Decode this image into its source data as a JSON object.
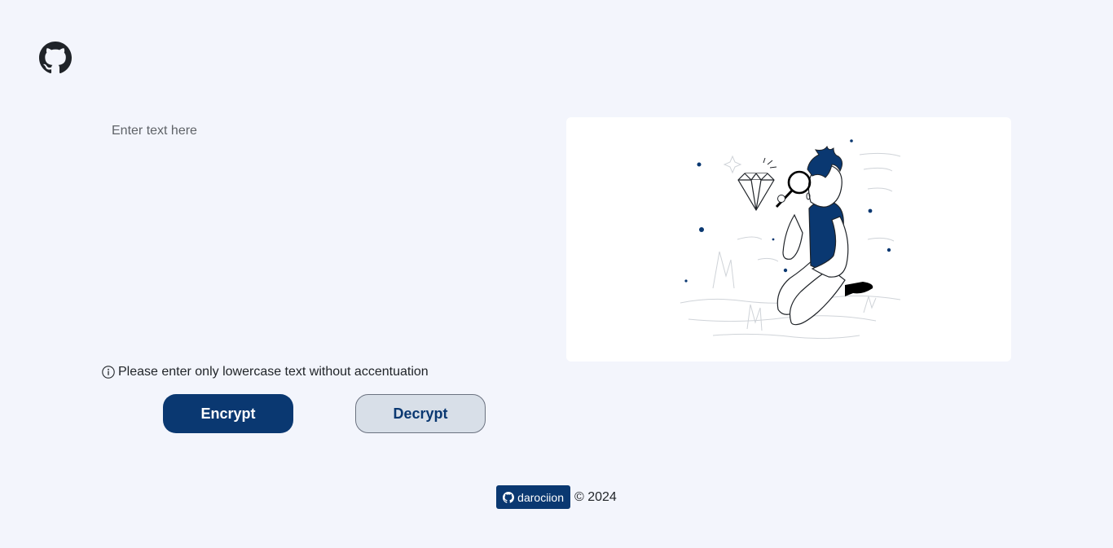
{
  "header": {
    "logo_icon": "github-icon"
  },
  "editor": {
    "placeholder": "Enter text here",
    "value": ""
  },
  "info": {
    "icon": "info-circle-icon",
    "text": "Please enter only lowercase text without accentuation"
  },
  "actions": {
    "encrypt_label": "Encrypt",
    "decrypt_label": "Decrypt"
  },
  "illustration": {
    "subject": "person-with-magnifying-glass-and-diamond"
  },
  "footer": {
    "author_icon": "github-icon",
    "author": "darociion",
    "copyright": "© 2024"
  },
  "colors": {
    "background": "#f3f5fc",
    "primary": "#0a3871",
    "secondary_button": "#d8dfe8",
    "card": "#ffffff"
  }
}
